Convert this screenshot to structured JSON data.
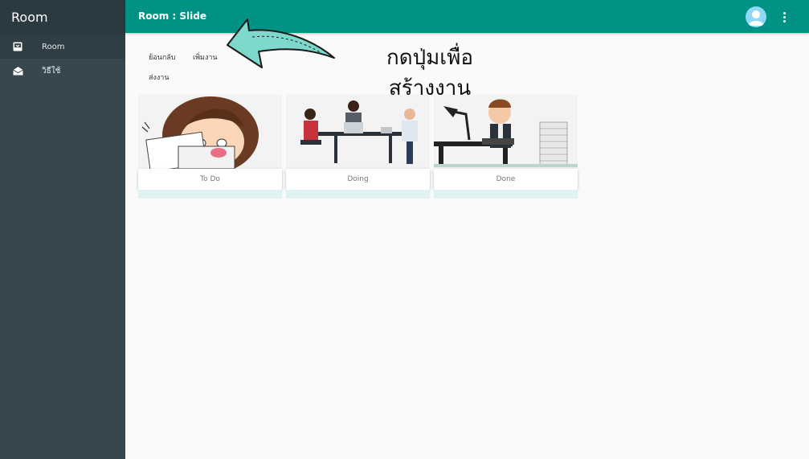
{
  "sidebar": {
    "title": "Room",
    "items": [
      {
        "label": "Room",
        "icon": "inbox-icon"
      },
      {
        "label": "วิธีใช้",
        "icon": "mail-open-icon"
      }
    ]
  },
  "topbar": {
    "title": "Room : Slide",
    "accent": "#009285"
  },
  "actions": {
    "back_label": "ย้อนกลับ",
    "add_label": "เพิ่มงาน",
    "send_label": "ส่งงาน"
  },
  "annotation": {
    "line1": "กดปุ่มเพื่อ",
    "line2": "สร้างงาน"
  },
  "boards": [
    {
      "label": "To Do"
    },
    {
      "label": "Doing"
    },
    {
      "label": "Done"
    }
  ]
}
